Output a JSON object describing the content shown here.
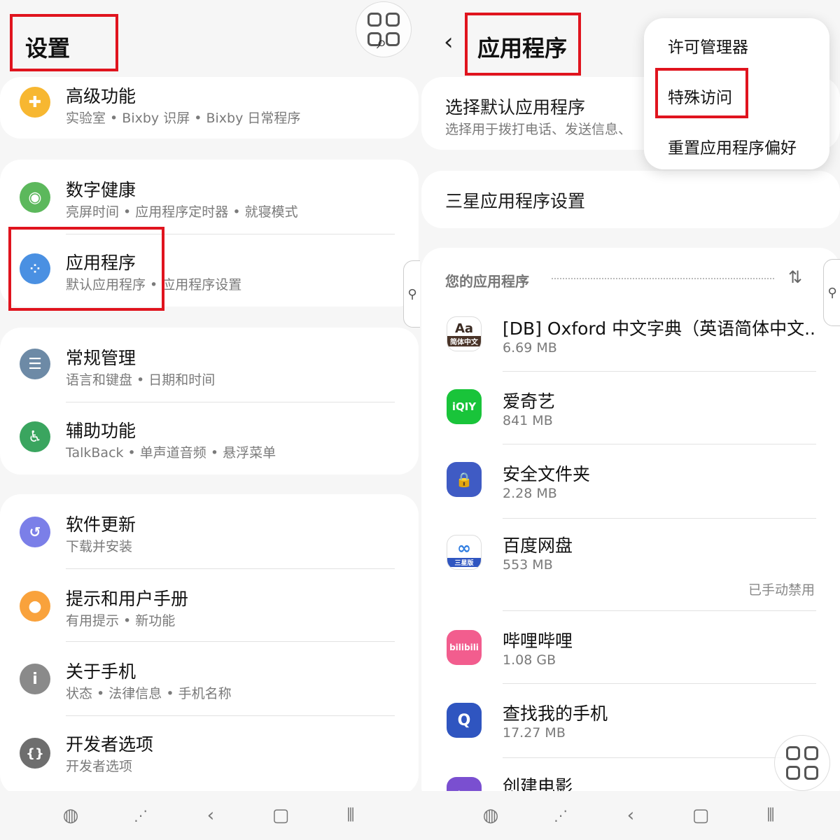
{
  "left": {
    "title": "设置",
    "groups": [
      {
        "items": [
          {
            "title": "高级功能",
            "sub": "实验室 • Bixby 识屏 • Bixby 日常程序",
            "icon": "puzzle-icon",
            "color": "#f7b731"
          }
        ]
      },
      {
        "items": [
          {
            "title": "数字健康",
            "sub": "亮屏时间 • 应用程序定时器 • 就寝模式",
            "icon": "wellbeing-icon",
            "color": "#5cb85c"
          },
          {
            "title": "应用程序",
            "sub": "默认应用程序 • 应用程序设置",
            "icon": "apps-icon",
            "color": "#4a90e2"
          }
        ]
      },
      {
        "items": [
          {
            "title": "常规管理",
            "sub": "语言和键盘 • 日期和时间",
            "icon": "sliders-icon",
            "color": "#6d8aa6"
          },
          {
            "title": "辅助功能",
            "sub": "TalkBack • 单声道音频 • 悬浮菜单",
            "icon": "accessibility-icon",
            "color": "#3aa55f"
          }
        ]
      },
      {
        "items": [
          {
            "title": "软件更新",
            "sub": "下载并安装",
            "icon": "update-icon",
            "color": "#7b7fe8"
          },
          {
            "title": "提示和用户手册",
            "sub": "有用提示 • 新功能",
            "icon": "bulb-icon",
            "color": "#f9a23c"
          },
          {
            "title": "关于手机",
            "sub": "状态 • 法律信息 • 手机名称",
            "icon": "info-icon",
            "color": "#8a8a8a"
          },
          {
            "title": "开发者选项",
            "sub": "开发者选项",
            "icon": "braces-icon",
            "color": "#6e6e6e"
          }
        ]
      }
    ]
  },
  "right": {
    "title": "应用程序",
    "default_apps": {
      "title": "选择默认应用程序",
      "sub": "选择用于拨打电话、发送信息、"
    },
    "samsung_settings": "三星应用程序设置",
    "section_label": "您的应用程序",
    "apps": [
      {
        "name": "[DB] Oxford 中文字典（英语简体中文..",
        "size": "6.69 MB",
        "icon": "oxford-dict-icon",
        "icon_text": "Aa",
        "icon_sub": "简体中文",
        "color": "#ffffff"
      },
      {
        "name": "爱奇艺",
        "size": "841 MB",
        "icon": "iqiyi-icon",
        "icon_text": "iQIY",
        "color": "#19c43a"
      },
      {
        "name": "安全文件夹",
        "size": "2.28 MB",
        "icon": "secure-folder-icon",
        "icon_text": "🔒",
        "color": "#3f5bc4"
      },
      {
        "name": "百度网盘",
        "size": "553 MB",
        "icon": "baidu-netdisk-icon",
        "icon_text": "∞",
        "icon_sub": "三星版",
        "color": "#ffffff",
        "note": "已手动禁用"
      },
      {
        "name": "哔哩哔哩",
        "size": "1.08 GB",
        "icon": "bilibili-icon",
        "icon_text": "bilibili",
        "color": "#f25d8e"
      },
      {
        "name": "查找我的手机",
        "size": "17.27 MB",
        "icon": "find-my-phone-icon",
        "icon_text": "Q",
        "color": "#2f55c0"
      },
      {
        "name": "创建电影",
        "size": "",
        "icon": "movie-maker-icon",
        "icon_text": "▶",
        "color": "#7a4fd0"
      }
    ],
    "menu": [
      "许可管理器",
      "特殊访问",
      "重置应用程序偏好"
    ]
  },
  "accessibility_tab": "⚲"
}
